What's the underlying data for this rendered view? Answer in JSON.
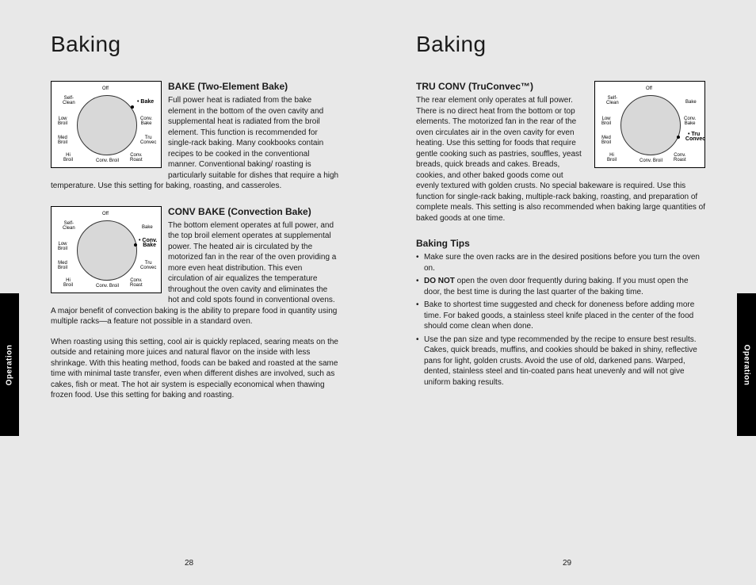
{
  "leftPage": {
    "title": "Baking",
    "tab": "Operation",
    "pageNumber": "28",
    "section1": {
      "heading": "BAKE (Two-Element Bake)",
      "text": "Full power heat is radiated from the bake element in the bottom of the oven cavity and supplemental heat is radiated from the broil element. This function is recommended for single-rack baking. Many cookbooks contain recipes to be cooked in the conventional manner. Conventional baking/ roasting is particularly suitable for dishes that require a high temperature. Use this setting for baking, roasting, and casseroles."
    },
    "section2": {
      "heading": "CONV BAKE (Convection Bake)",
      "text": "The bottom element operates at full power, and the top broil element operates at supplemental power. The heated air is circulated by the motorized fan in the rear of the oven providing a more even heat distribution. This even circulation of air equalizes the temperature throughout the oven cavity and eliminates the hot and cold spots found in conventional ovens. A major benefit of convection baking is the ability to prepare food in quantity using multiple racks—a feature not possible in a standard oven.",
      "text2": "When roasting using this setting, cool air is quickly replaced, searing meats on the outside and retaining more juices and natural flavor on the inside with less shrinkage. With this heating method, foods can be baked and roasted at the same time with minimal taste transfer, even when different dishes are involved, such as cakes, fish or meat. The hot air system is especially economical when thawing frozen food. Use this setting for baking and roasting."
    },
    "dial": {
      "labels": [
        "Off",
        "Bake",
        "Conv. Bake",
        "Tru Convec",
        "Conv. Roast",
        "Conv. Broil",
        "Hi Broil",
        "Med Broil",
        "Low Broil",
        "Self- Clean"
      ],
      "bold1": "Bake",
      "bold2": "Conv. Bake"
    }
  },
  "rightPage": {
    "title": "Baking",
    "tab": "Operation",
    "pageNumber": "29",
    "section1": {
      "heading": "TRU CONV (TruConvec™)",
      "text": "The rear element only operates at full power. There is no direct heat from the bottom or top elements. The motorized fan in the rear of the oven circulates air in the oven cavity for even heating. Use this setting for foods that require gentle cooking such as pastries, souffles, yeast breads, quick breads and cakes. Breads, cookies, and other baked goods come out evenly textured with golden crusts. No special bakeware is required. Use this function for single-rack baking, multiple-rack baking, roasting, and preparation of complete meals. This setting is also recommended when baking large quantities of baked goods at one time."
    },
    "tips": {
      "heading": "Baking Tips",
      "items": [
        "Make sure the oven racks are in the desired positions before you turn the oven on.",
        "open the oven door frequently during baking. If you must open the door, the best time is during the last quarter of the baking time.",
        "Bake to shortest time suggested and check for doneness before adding more time. For baked goods, a stainless steel knife placed in the center of the food should come clean when done.",
        "Use the pan size and type recommended by the recipe to ensure best results. Cakes, quick breads, muffins, and cookies should be baked in shiny, reflective pans for light, golden crusts. Avoid the use of old, darkened pans. Warped, dented, stainless steel and tin-coated pans heat unevenly and will not give uniform baking results."
      ],
      "doNot": "DO NOT "
    },
    "dial": {
      "bold": "Tru Convec"
    }
  }
}
